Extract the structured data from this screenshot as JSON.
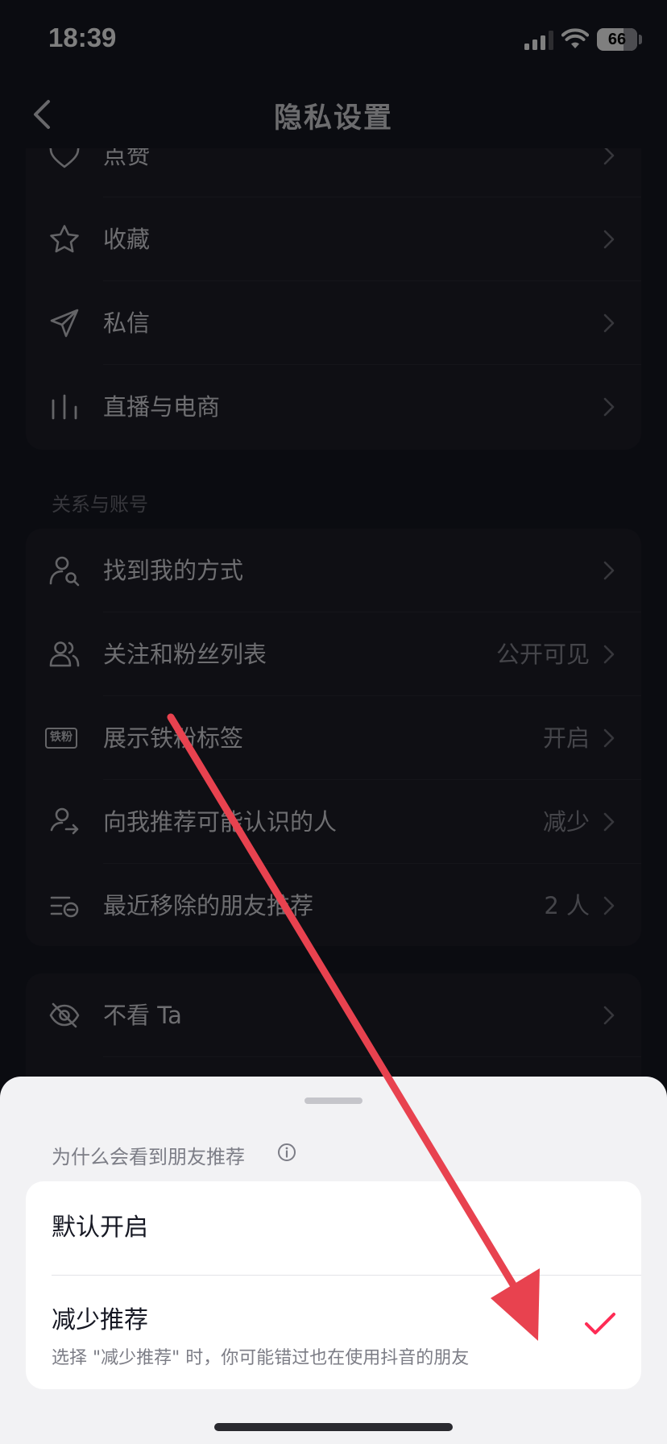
{
  "status_bar": {
    "time": "18:39",
    "battery": "66",
    "battery_level": 0.66
  },
  "header": {
    "title": "隐私设置"
  },
  "card1": {
    "items": [
      {
        "label": "点赞",
        "icon": "heart-icon"
      },
      {
        "label": "收藏",
        "icon": "star-icon"
      },
      {
        "label": "私信",
        "icon": "send-icon"
      },
      {
        "label": "直播与电商",
        "icon": "bar-chart-icon"
      }
    ]
  },
  "section_title": "关系与账号",
  "card2": {
    "items": [
      {
        "label": "找到我的方式",
        "value": "",
        "icon": "user-search-icon"
      },
      {
        "label": "关注和粉丝列表",
        "value": "公开可见",
        "icon": "users-icon"
      },
      {
        "label": "展示铁粉标签",
        "value": "开启",
        "icon": "fan-badge-icon",
        "badge": "铁粉"
      },
      {
        "label": "向我推荐可能认识的人",
        "value": "减少",
        "icon": "user-recommend-icon"
      },
      {
        "label": "最近移除的朋友推荐",
        "value": "2 人",
        "icon": "list-removed-icon"
      }
    ]
  },
  "card3": {
    "items": [
      {
        "label": "不看 Ta",
        "icon": "eye-off-icon"
      }
    ]
  },
  "sheet": {
    "header": "为什么会看到朋友推荐",
    "options": [
      {
        "label": "默认开启",
        "selected": false
      },
      {
        "label": "减少推荐",
        "desc": "选择 \"减少推荐\" 时，你可能错过也在使用抖音的朋友",
        "selected": true
      }
    ]
  },
  "colors": {
    "accent": "#fe2c55",
    "annotation_arrow": "#e8424f",
    "background": "#161823"
  }
}
